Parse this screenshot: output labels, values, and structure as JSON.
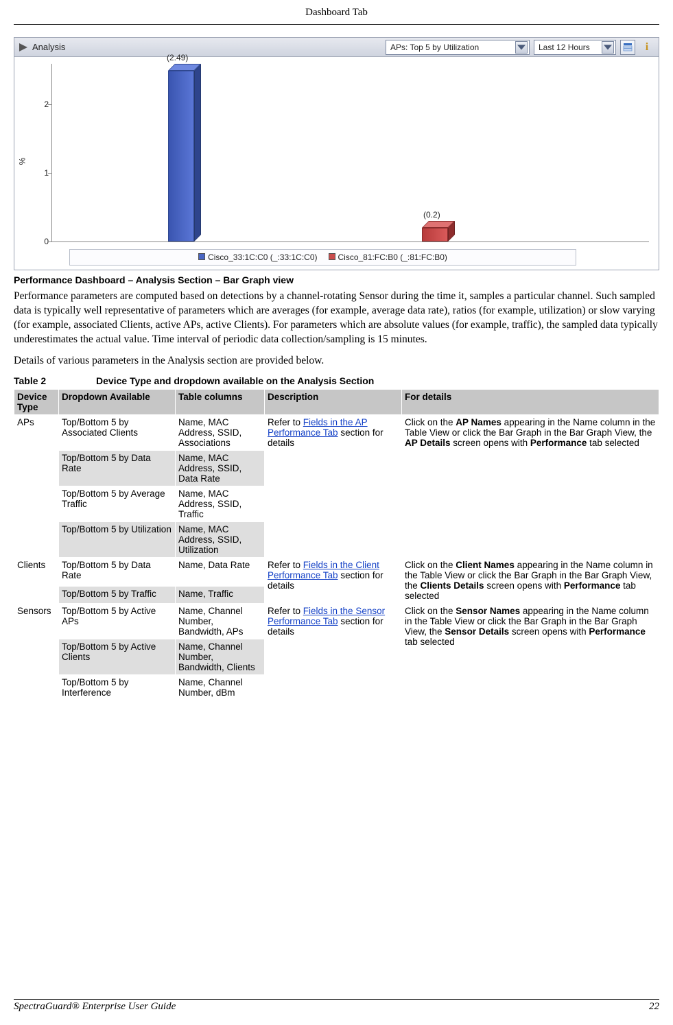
{
  "header": {
    "title": "Dashboard Tab"
  },
  "panel": {
    "title": "Analysis",
    "dd1": "APs: Top 5 by Utilization",
    "dd2": "Last 12 Hours"
  },
  "chart_data": {
    "type": "bar",
    "ylabel": "%",
    "ylim": [
      0,
      2.6
    ],
    "yticks": [
      0,
      1,
      2
    ],
    "series": [
      {
        "name": "Cisco_33:1C:C0 (_:33:1C:C0)",
        "value": 2.49,
        "color": "#4a66c4"
      },
      {
        "name": "Cisco_81:FC:B0 (_:81:FC:B0)",
        "value": 0.2,
        "color": "#c94c4c"
      }
    ]
  },
  "caption": "Performance Dashboard – Analysis Section – Bar Graph view",
  "para1": "Performance parameters are computed based on detections by a channel-rotating Sensor during the time it, samples a particular channel. Such sampled data is typically well representative of parameters which are averages (for example, average data rate), ratios (for example, utilization) or slow varying (for example, associated Clients, active APs, active Clients). For parameters which are absolute values (for example, traffic), the sampled data typically underestimates the actual value. Time interval of periodic data collection/sampling is 15 minutes.",
  "para2": "Details of various parameters in the Analysis section are provided below.",
  "table": {
    "number": "Table 2",
    "title": "Device Type and dropdown available on the Analysis Section",
    "headers": [
      "Device Type",
      "Dropdown Available",
      "Table columns",
      "Description",
      "For details"
    ],
    "groups": [
      {
        "device": "APs",
        "desc_link": "Fields in the AP Performance Tab",
        "desc_pre": "Refer to ",
        "desc_post": " section for details",
        "details_parts": [
          "Click on the ",
          "AP Names",
          " appearing in the Name column in the Table View or click the Bar Graph in the Bar Graph View, the ",
          "AP Details",
          " screen opens with ",
          "Performance",
          " tab selected"
        ],
        "rows": [
          {
            "dd": "Top/Bottom 5 by Associated Clients",
            "cols": "Name, MAC Address, SSID, Associations"
          },
          {
            "dd": "Top/Bottom 5 by Data Rate",
            "cols": "Name, MAC Address, SSID, Data Rate"
          },
          {
            "dd": "Top/Bottom 5 by Average Traffic",
            "cols": "Name, MAC Address, SSID, Traffic"
          },
          {
            "dd": "Top/Bottom 5 by Utilization",
            "cols": "Name, MAC Address, SSID, Utilization"
          }
        ]
      },
      {
        "device": "Clients",
        "desc_link": "Fields in the Client Performance Tab",
        "desc_pre": "Refer to ",
        "desc_post": " section for details",
        "details_parts": [
          "Click on the ",
          "Client Names",
          " appearing in the Name column in the Table View or click the Bar Graph in the Bar Graph View, the ",
          "Clients Details",
          " screen opens with ",
          "Performance",
          " tab selected"
        ],
        "rows": [
          {
            "dd": "Top/Bottom 5 by Data Rate",
            "cols": "Name, Data Rate"
          },
          {
            "dd": "Top/Bottom 5 by Traffic",
            "cols": "Name, Traffic"
          }
        ]
      },
      {
        "device": "Sensors",
        "desc_link": "Fields in the Sensor Performance Tab",
        "desc_pre": "Refer to ",
        "desc_post": " section for details",
        "details_parts": [
          "Click on the ",
          "Sensor Names",
          " appearing in the Name column in the Table View or click the Bar Graph in the Bar Graph View, the ",
          "Sensor Details",
          " screen opens with ",
          "Performance",
          " tab selected"
        ],
        "rows": [
          {
            "dd": "Top/Bottom 5 by Active APs",
            "cols": "Name, Channel Number, Bandwidth, APs"
          },
          {
            "dd": "Top/Bottom 5 by Active Clients",
            "cols": "Name, Channel Number, Bandwidth, Clients"
          },
          {
            "dd": "Top/Bottom 5 by Interference",
            "cols": "Name, Channel Number, dBm"
          }
        ]
      }
    ]
  },
  "footer": {
    "guide": "SpectraGuard® Enterprise User Guide",
    "page": "22"
  }
}
